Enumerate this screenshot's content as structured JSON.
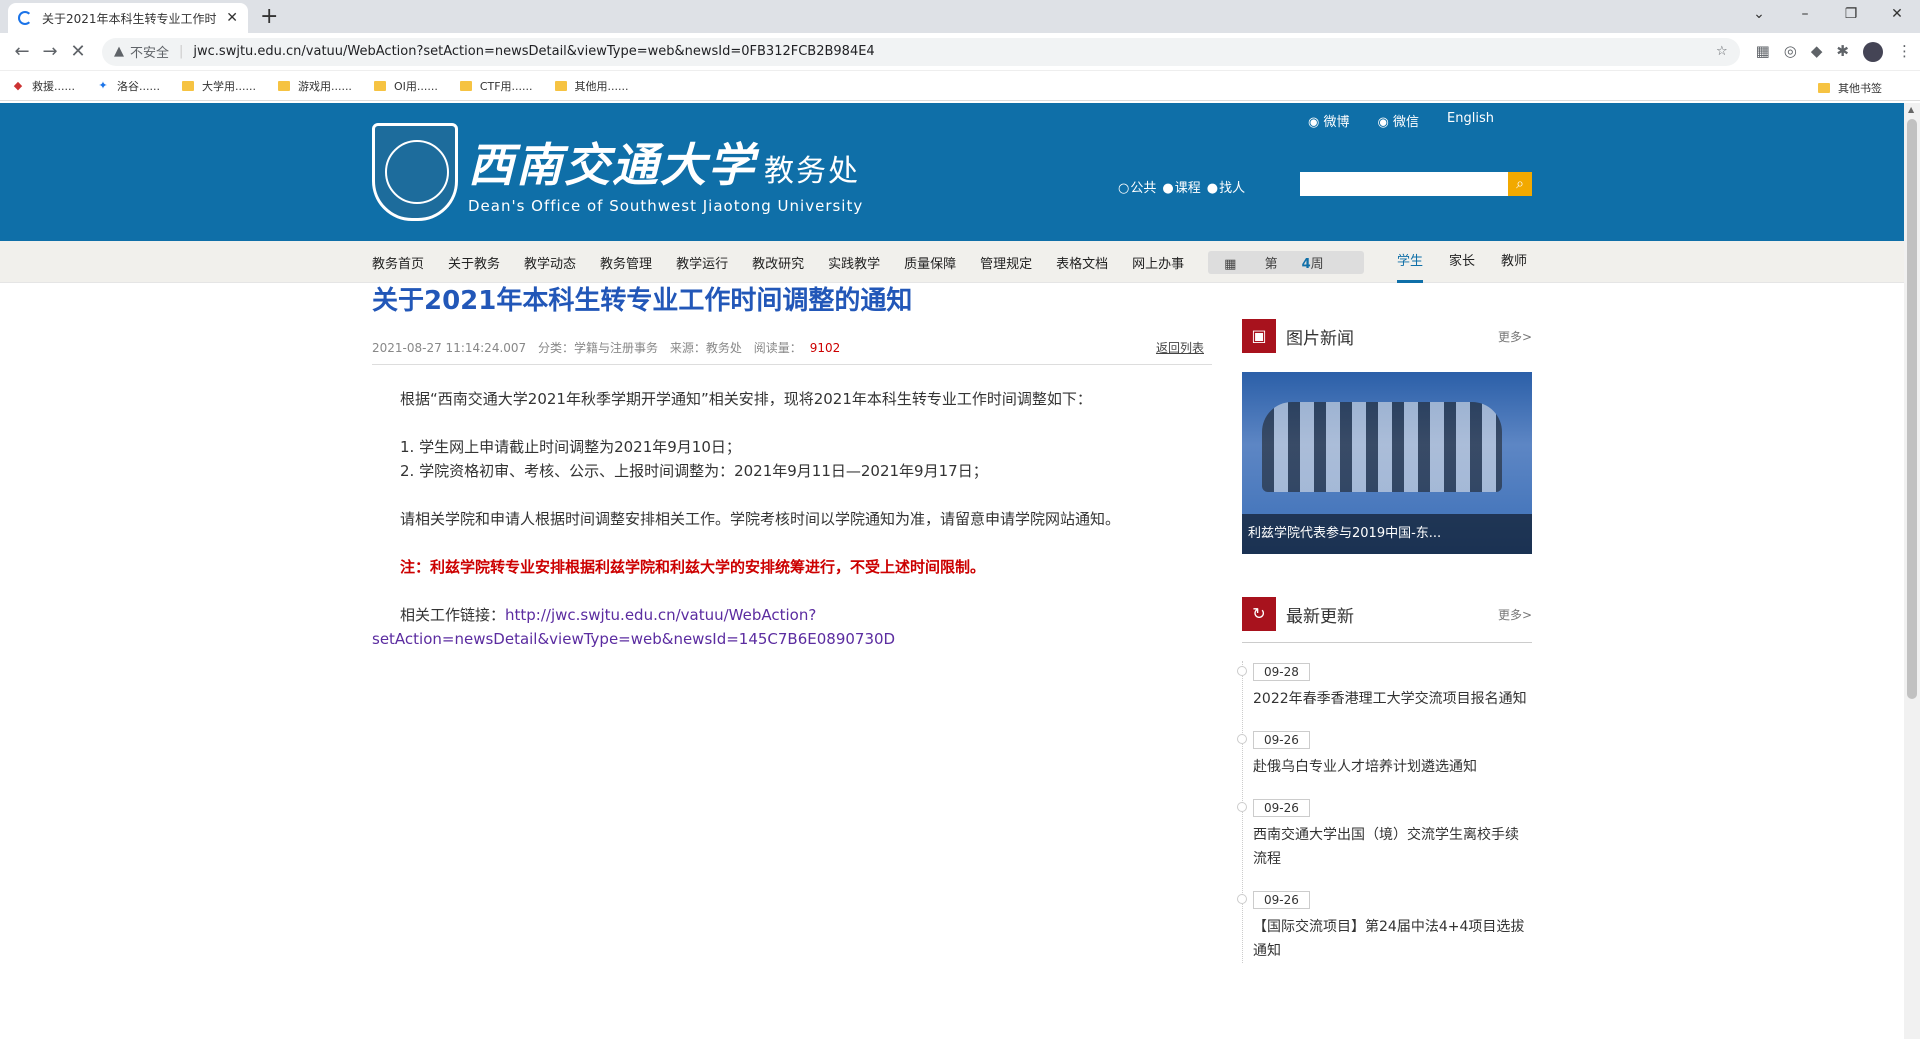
{
  "browser": {
    "tab_title": "关于2021年本科生转专业工作时",
    "security_label": "不安全",
    "url": "jwc.swjtu.edu.cn/vatuu/WebAction?setAction=newsDetail&viewType=web&newsId=0FB312FCB2B984E4",
    "bookmarks": [
      "救援......",
      "洛谷......",
      "大学用......",
      "游戏用......",
      "OI用......",
      "CTF用......",
      "其他用......"
    ],
    "other_bookmarks": "其他书签"
  },
  "header": {
    "logo_cn": "西南交通大学",
    "logo_office": "教务处",
    "logo_en": "Dean's Office of Southwest Jiaotong University",
    "social": [
      "微博",
      "微信",
      "English"
    ],
    "search_scopes": [
      "公共",
      "课程",
      "找人"
    ]
  },
  "nav": {
    "items": [
      "教务首页",
      "关于教务",
      "教学动态",
      "教务管理",
      "教学运行",
      "教改研究",
      "实践教学",
      "质量保障",
      "管理规定",
      "表格文档",
      "网上办事"
    ],
    "week_prefix": "第",
    "week_num": "4",
    "week_suffix": "周",
    "roles": [
      "学生",
      "家长",
      "教师"
    ]
  },
  "article": {
    "title": "关于2021年本科生转专业工作时间调整的通知",
    "datetime": "2021-08-27 11:14:24.007",
    "category": "分类：学籍与注册事务",
    "source": "来源：教务处",
    "views_label": "阅读量：",
    "views": "9102",
    "back": "返回列表",
    "p1": "根据“西南交通大学2021年秋季学期开学通知”相关安排，现将2021年本科生转专业工作时间调整如下：",
    "item1": "1. 学生网上申请截止时间调整为2021年9月10日；",
    "item2": "2. 学院资格初审、考核、公示、上报时间调整为：2021年9月11日—2021年9月17日；",
    "p2": "请相关学院和申请人根据时间调整安排相关工作。学院考核时间以学院通知为准，请留意申请学院网站通知。",
    "note": "注：利兹学院转专业安排根据利兹学院和利兹大学的安排统筹进行，不受上述时间限制。",
    "link_label": "相关工作链接：",
    "link": "http://jwc.swjtu.edu.cn/vatuu/WebAction?setAction=newsDetail&viewType=web&newsId=145C7B6E0890730D"
  },
  "sidebar": {
    "photo_title": "图片新闻",
    "more": "更多>",
    "photo_caption": "利兹学院代表参与2019中国-东...",
    "latest_title": "最新更新",
    "news": [
      {
        "date": "09-28",
        "text": "2022年春季香港理工大学交流项目报名通知"
      },
      {
        "date": "09-26",
        "text": "赴俄乌白专业人才培养计划遴选通知"
      },
      {
        "date": "09-26",
        "text": "西南交通大学出国（境）交流学生离校手续流程"
      },
      {
        "date": "09-26",
        "text": "【国际交流项目】第24届中法4+4项目选拔通知"
      }
    ]
  }
}
